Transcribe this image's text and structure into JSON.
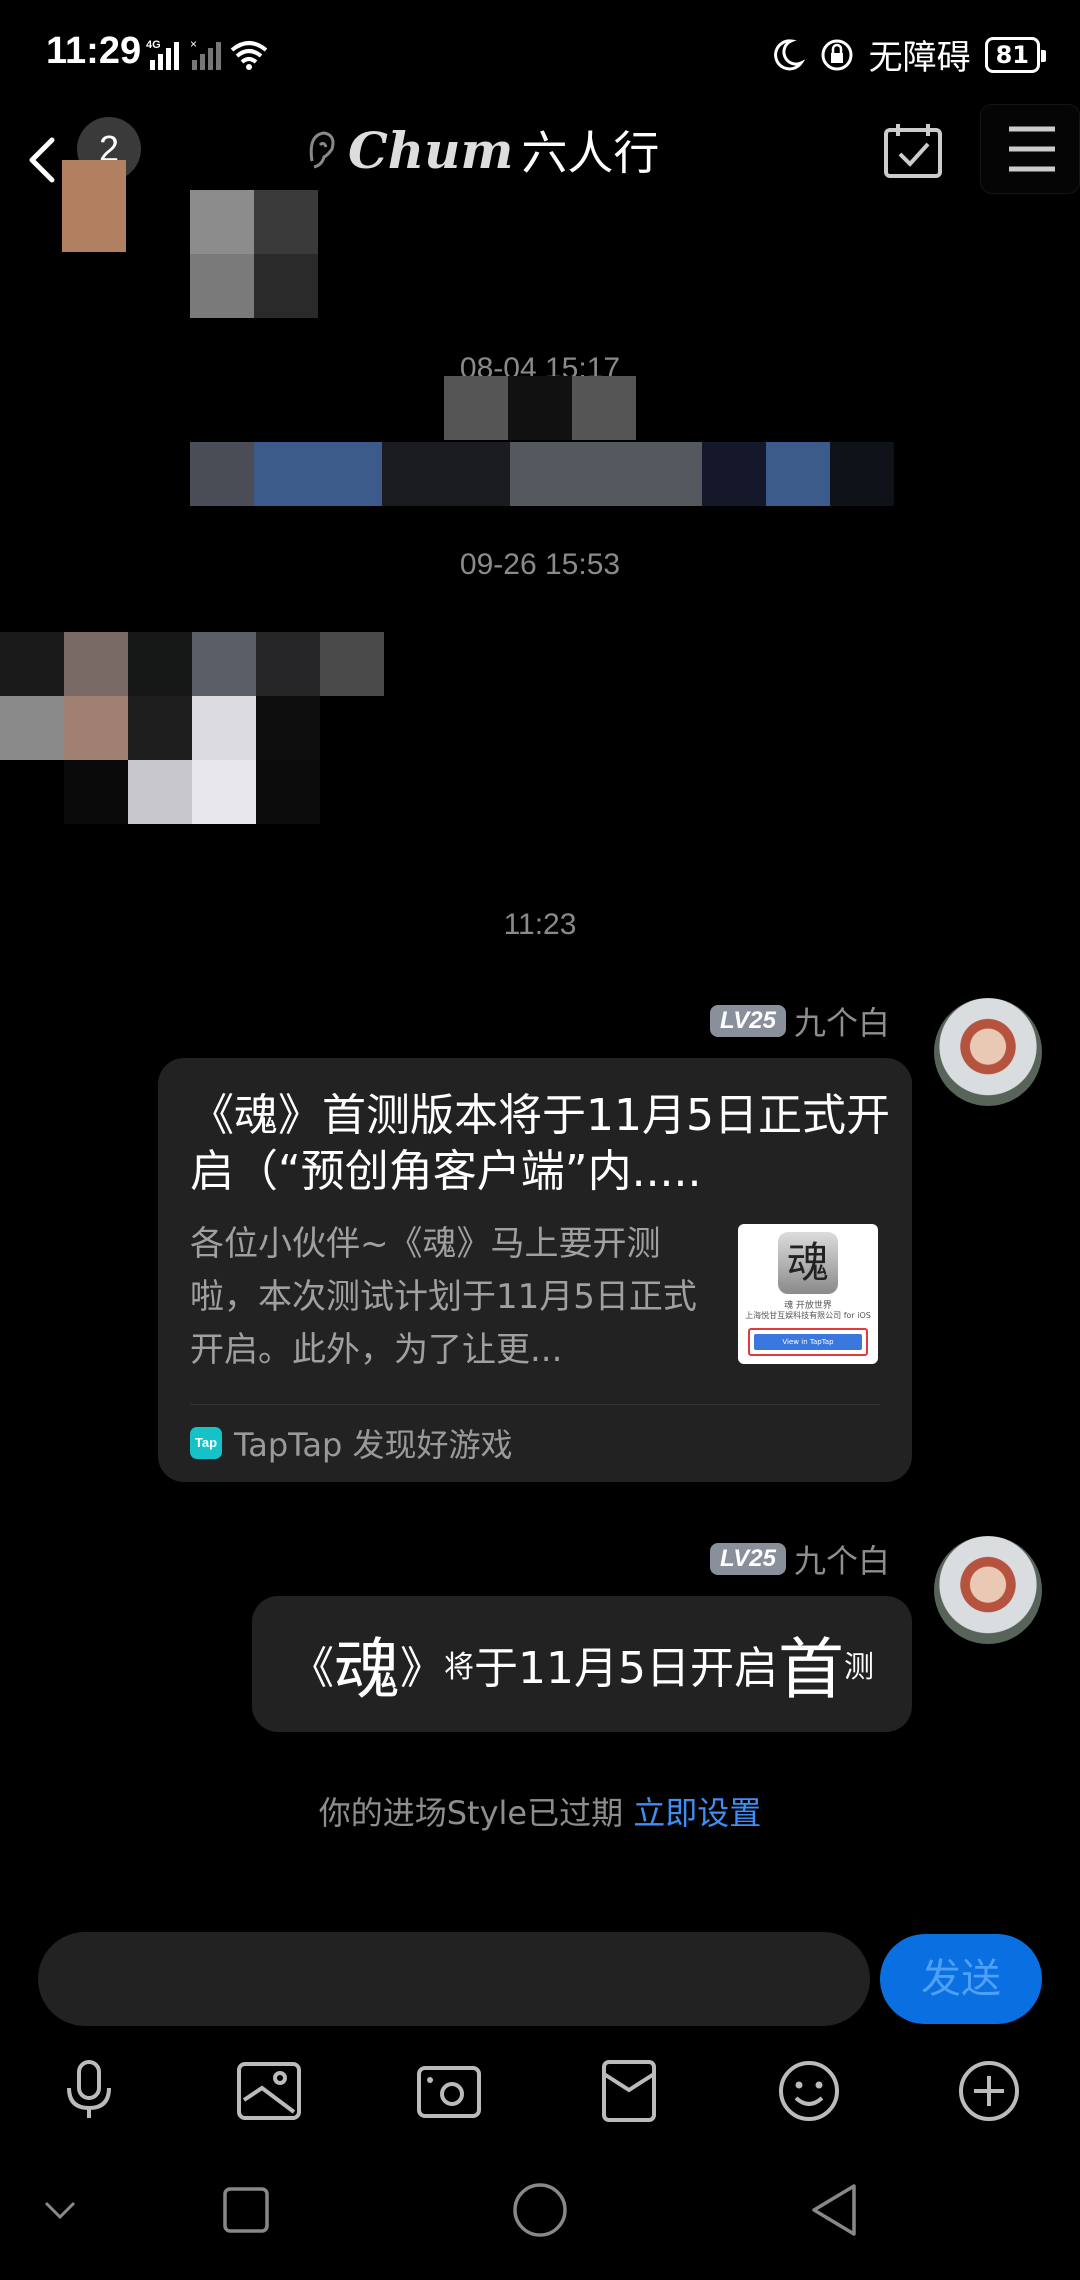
{
  "status_bar": {
    "time": "11:29",
    "network": "4G",
    "accessibility": "无障碍",
    "battery": "81"
  },
  "header": {
    "unread_count": "2",
    "title_logo": "Chum",
    "title": "六人行"
  },
  "messages": {
    "timestamp_1": "08-04 15:17",
    "timestamp_2": "09-26 15:53",
    "timestamp_3": "11:23",
    "sender_level": "LV25",
    "sender_name": "九个白",
    "link_card": {
      "title": "《魂》首测版本将于11月5日正式开启（“预创角客户端”内.....",
      "description": "各位小伙伴~《魂》马上要开测啦，本次测试计划于11月5日正式开启。此外，为了让更...",
      "thumb_logo": "魂",
      "thumb_line1": "魂 开放世界",
      "thumb_line2": "上海悦甘互娱科技有限公司 for iOS",
      "thumb_button": "View in TapTap",
      "source_icon": "Tap",
      "source": "TapTap 发现好游戏"
    },
    "text_bubble": {
      "part1": "《",
      "part2": "魂",
      "part3": "》",
      "part4": "将",
      "part5": "于11月5日开启",
      "part6": "首",
      "part7": "测"
    }
  },
  "notice": {
    "text": "你的进场Style已过期 ",
    "link": "立即设置"
  },
  "input": {
    "placeholder": "",
    "send_label": "发送"
  },
  "colors": {
    "background": "#000000",
    "bubble": "#222222",
    "accent": "#0a6fe0",
    "link": "#3f8ef5"
  },
  "icons": {
    "toolbar": [
      "microphone-icon",
      "image-icon",
      "camera-icon",
      "red-packet-icon",
      "emoji-icon",
      "plus-icon"
    ],
    "navbar": [
      "hide-keyboard-icon",
      "recents-icon",
      "home-icon",
      "back-icon"
    ]
  }
}
